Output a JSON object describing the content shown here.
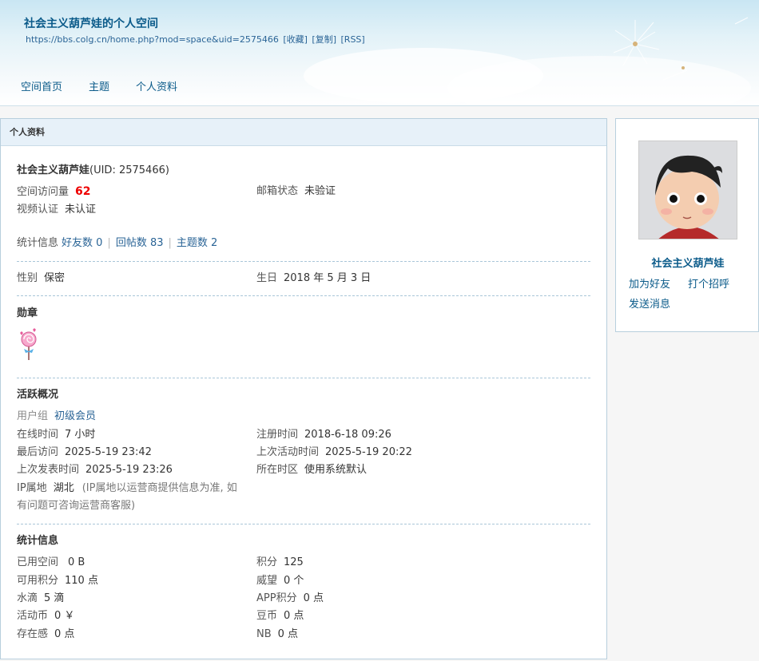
{
  "header": {
    "title": "社会主义葫芦娃的个人空间",
    "url": "https://bbs.colg.cn/home.php?mod=space&uid=2575466",
    "fav": "[收藏]",
    "copy": "[复制]",
    "rss": "[RSS]",
    "nav": [
      "空间首页",
      "主题",
      "个人资料"
    ]
  },
  "panel_title": "个人资料",
  "profile": {
    "name": "社会主义葫芦娃",
    "uid": "(UID: 2575466)",
    "visits_label": "空间访问量",
    "visits": "62",
    "email_label": "邮箱状态",
    "email": "未验证",
    "video_label": "视频认证",
    "video": "未认证",
    "stats_label": "统计信息",
    "friends": "好友数 0",
    "replies": "回帖数 83",
    "threads": "主题数 2",
    "gender_label": "性别",
    "gender": "保密",
    "birthday_label": "生日",
    "birthday": "2018 年 5 月 3 日"
  },
  "medals": {
    "title": "勋章",
    "icon": "lollipop-medal-icon"
  },
  "activity": {
    "title": "活跃概况",
    "group_label": "用户组",
    "group": "初级会员",
    "online_label": "在线时间",
    "online": "7 小时",
    "reg_label": "注册时间",
    "reg": "2018-6-18 09:26",
    "lastvisit_label": "最后访问",
    "lastvisit": "2025-5-19 23:42",
    "lastactive_label": "上次活动时间",
    "lastactive": "2025-5-19 20:22",
    "lastpost_label": "上次发表时间",
    "lastpost": "2025-5-19 23:26",
    "tz_label": "所在时区",
    "tz": "使用系统默认",
    "ip_label": "IP属地",
    "ip": "湖北",
    "ip_note_1": "(IP属地以运营商提供信息为准, 如",
    "ip_note_2": "有问题可咨询运营商客服)"
  },
  "stats": {
    "title": "统计信息",
    "used_space_label": "已用空间",
    "used_space": "0 B",
    "points_label": "积分",
    "points": "125",
    "avail_points_label": "可用积分",
    "avail_points": "110 点",
    "prestige_label": "威望",
    "prestige": "0 个",
    "water_label": "水滴",
    "water": "5 滴",
    "app_points_label": "APP积分",
    "app_points": "0 点",
    "coins_label": "活动币",
    "coins": "0 ￥",
    "beans_label": "豆币",
    "beans": "0 点",
    "presence_label": "存在感",
    "presence": "0 点",
    "nb_label": "NB",
    "nb": "0 点"
  },
  "sidebar": {
    "name": "社会主义葫芦娃",
    "add_friend": "加为好友",
    "greet": "打个招呼",
    "message": "发送消息"
  },
  "colors": {
    "link": "#0b5b8a",
    "accent_red": "#e00000",
    "panel_header_bg": "#e7f1f9"
  }
}
